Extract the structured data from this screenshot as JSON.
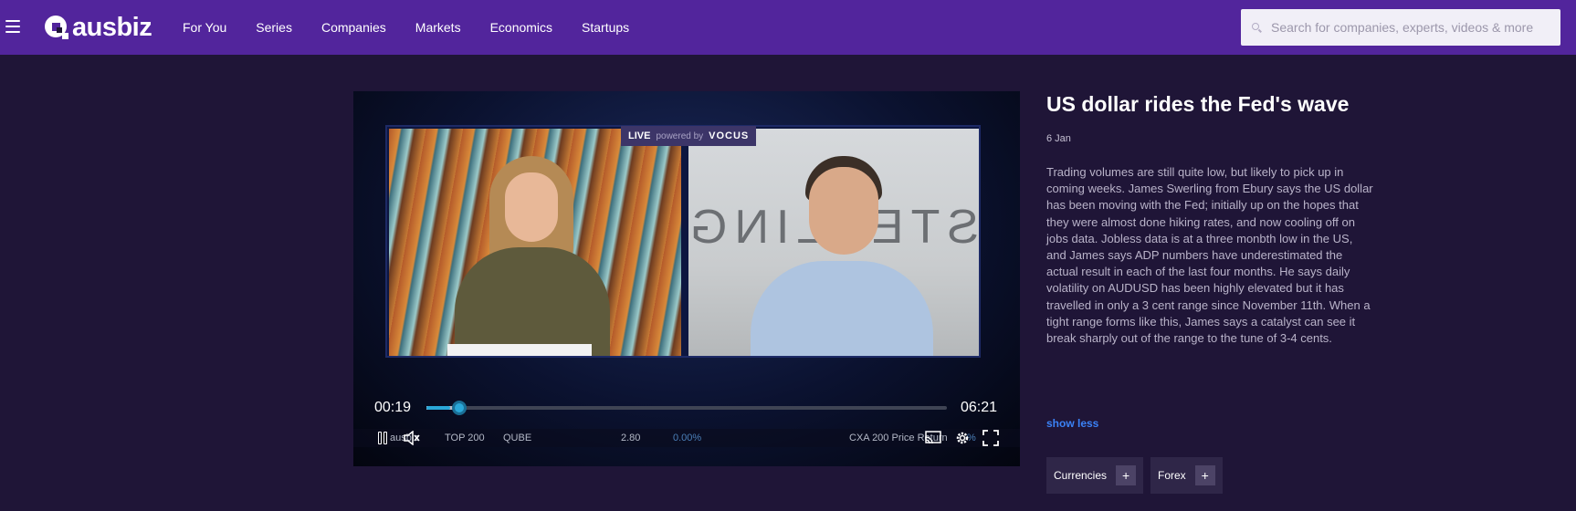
{
  "brand": {
    "name": "ausbiz"
  },
  "nav": {
    "items": [
      {
        "label": "For You"
      },
      {
        "label": "Series"
      },
      {
        "label": "Companies"
      },
      {
        "label": "Markets"
      },
      {
        "label": "Economics"
      },
      {
        "label": "Startups"
      }
    ]
  },
  "search": {
    "placeholder": "Search for companies, experts, videos & more"
  },
  "player": {
    "live_label": "LIVE",
    "powered_by": "powered by",
    "sponsor": "VOCUS",
    "screen_text": "STERLING",
    "current_time": "00:19",
    "total_time": "06:21",
    "progress": 0.046,
    "buffered": 0.06,
    "ticker": {
      "brand": "ausbiz",
      "index": "TOP 200",
      "symbol": "QUBE",
      "price": "2.80",
      "change": "0.00%",
      "index2": "CXA 200 Price Return",
      "change2": "%"
    }
  },
  "article": {
    "title": "US dollar rides the Fed's wave",
    "date": "6 Jan",
    "body": "Trading volumes are still quite low, but likely to pick up in coming weeks. James Swerling from Ebury says the US dollar has been moving with the Fed; initially up on the hopes that they were almost done hiking rates, and now cooling off on jobs data. Jobless data is at a three monbth low in the US, and James says ADP numbers have underestimated the actual result in each of the last four months. He says daily volatility on AUDUSD has been highly elevated but it has travelled in only a 3 cent range since November 11th. When a tight range forms like this, James says a catalyst can see it break sharply out of the range to the tune of 3-4 cents.",
    "show_less": "show less",
    "tags": [
      {
        "label": "Currencies",
        "action": "+"
      },
      {
        "label": "Forex",
        "action": "+"
      }
    ]
  },
  "colors": {
    "nav_bg": "#52259c",
    "page_bg": "#1f1537",
    "accent": "#2aa7d8",
    "link": "#3b82f6"
  }
}
